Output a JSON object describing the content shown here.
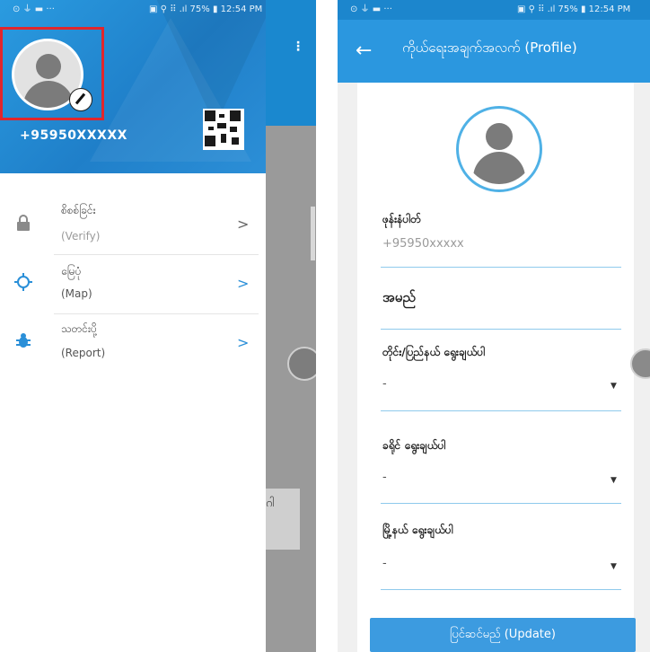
{
  "left_phone": {
    "status_time": "12:54 PM",
    "status_battery": "75%",
    "phone_number": "+95950XXXXX",
    "menu": [
      {
        "label_mm": "စိစစ်ခြင်း",
        "label_en": "(Verify)",
        "icon": "lock-icon"
      },
      {
        "label_mm": "မြေပုံ",
        "label_en": "(Map)",
        "icon": "crosshair-icon"
      },
      {
        "label_mm": "သတင်းပို့",
        "label_en": "(Report)",
        "icon": "bug-icon"
      }
    ],
    "chevron": ">",
    "behind_card_text": "ဂါ",
    "colors": {
      "header": "#1f7fc9",
      "highlight": "#e1262c"
    }
  },
  "right_phone": {
    "status_time": "12:54 PM",
    "status_battery": "75%",
    "title": "ကိုယ်ရေးအချက်အလက် (Profile)",
    "back_icon": "arrow-left-icon",
    "fields": [
      {
        "label": "ဖုန်းနံပါတ်",
        "value": "+95950xxxxx"
      },
      {
        "label": "အမည်",
        "value": ""
      },
      {
        "label": "တိုင်း/ပြည်နယ် ရွေးချယ်ပါ",
        "value": "-"
      },
      {
        "label": "ခရိုင် ရွေးချယ်ပါ",
        "value": "-"
      },
      {
        "label": "မြို့နယ် ရွေးချယ်ပါ",
        "value": "-"
      }
    ],
    "update_button": "ပြင်ဆင်မည် (Update)",
    "colors": {
      "appbar": "#2b97df",
      "button": "#3c9be0",
      "accent": "#4fb1e6"
    }
  }
}
